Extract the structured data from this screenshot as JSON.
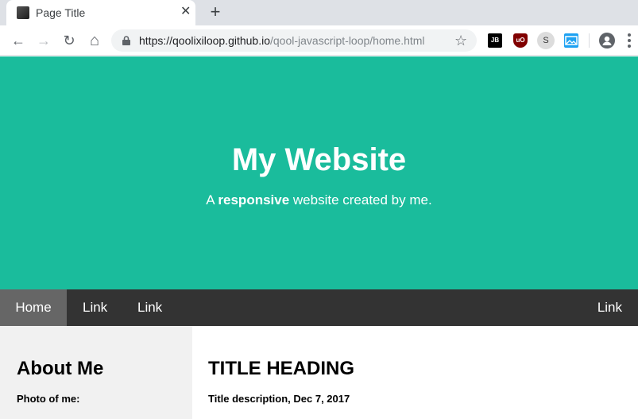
{
  "browser": {
    "tab": {
      "title": "Page Title",
      "close": "✕"
    },
    "new_tab": "+",
    "nav": {
      "back": "←",
      "forward": "→",
      "reload": "↻",
      "home": "⌂"
    },
    "url": {
      "host": "https://qoolixiloop.github.io",
      "path": "/qool-javascript-loop/home.html"
    },
    "bookmark": "☆",
    "extensions": {
      "jb": "JB",
      "ublock": "uO",
      "s": "S"
    }
  },
  "header": {
    "title": "My Website",
    "subtitle_pre": "A ",
    "subtitle_bold": "responsive",
    "subtitle_post": " website created by me."
  },
  "navbar": {
    "items": [
      {
        "label": "Home",
        "active": true
      },
      {
        "label": "Link"
      },
      {
        "label": "Link"
      }
    ],
    "right_item": {
      "label": "Link"
    }
  },
  "side": {
    "title": "About Me",
    "photo_label": "Photo of me:"
  },
  "main": {
    "title": "TITLE HEADING",
    "description": "Title description, Dec 7, 2017"
  },
  "colors": {
    "header_bg": "#1abc9c",
    "navbar_bg": "#333333",
    "navbar_active": "#666666",
    "side_bg": "#f1f1f1"
  }
}
